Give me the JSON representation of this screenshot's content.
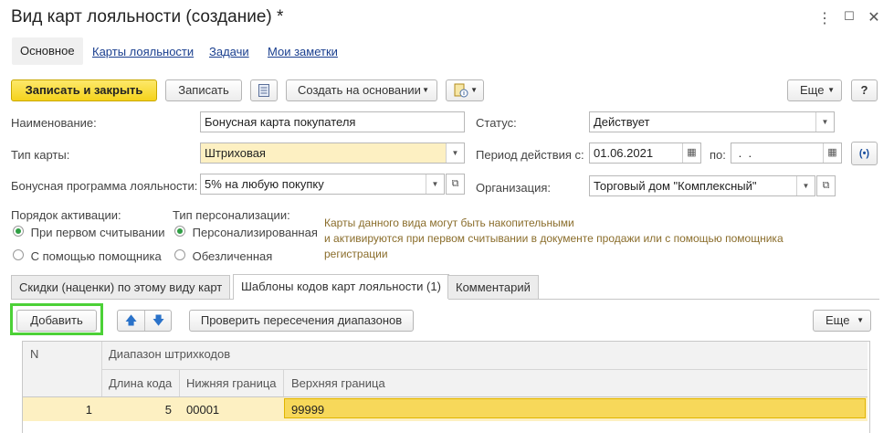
{
  "window": {
    "title": "Вид карт лояльности (создание) *",
    "buttons": [
      "⋮",
      "☐",
      "✕"
    ]
  },
  "nav_tabs": [
    {
      "label": "Основное"
    },
    {
      "label": "Карты лояльности"
    },
    {
      "label": "Задачи"
    },
    {
      "label": "Мои заметки"
    }
  ],
  "toolbar": {
    "save_close_label": "Записать и закрыть",
    "save_label": "Записать",
    "create_based_label": "Создать на основании",
    "more_label": "Еще",
    "help_label": "?"
  },
  "form": {
    "name_label": "Наименование:",
    "name_value": "Бонусная карта покупателя",
    "card_type_label": "Тип карты:",
    "card_type_value": "Штриховая",
    "program_label": "Бонусная программа лояльности:",
    "program_value": "5% на любую покупку",
    "status_label": "Статус:",
    "status_value": "Действует",
    "period_label": "Период действия с:",
    "period_from": "01.06.2021",
    "period_to_label": "по:",
    "period_to": " .  .",
    "org_label": "Организация:",
    "org_value": "Торговый дом \"Комплексный\""
  },
  "activation": {
    "label": "Порядок активации:",
    "options": [
      "При первом считывании",
      "С помощью помощника"
    ],
    "selected": 0
  },
  "personalization": {
    "label": "Тип персонализации:",
    "options": [
      "Персонализированная",
      "Обезличенная"
    ],
    "selected": 0
  },
  "note": {
    "lines": [
      "Карты данного вида могут быть накопительными",
      "и активируются при первом считывании в документе продажи или с помощью помощника",
      "регистрации"
    ]
  },
  "page_tabs": [
    {
      "label": "Скидки (наценки) по этому виду карт"
    },
    {
      "label": "Шаблоны кодов карт лояльности (1)"
    },
    {
      "label": "Комментарий"
    }
  ],
  "grid_toolbar": {
    "add_label": "Добавить",
    "check_label": "Проверить пересечения диапазонов",
    "more_label": "Еще"
  },
  "table": {
    "col_n": "N",
    "group_header": "Диапазон штрихкодов",
    "col_length": "Длина кода",
    "col_lower": "Нижняя граница",
    "col_upper": "Верхняя граница",
    "rows": [
      {
        "n": "1",
        "length": "5",
        "lower": "00001",
        "upper": "99999"
      }
    ]
  },
  "colors": {
    "accent_yellow": "#f5d21c",
    "highlight_green": "#4cd137",
    "selected_row": "#fdf0c2",
    "link_blue": "#1a3f8f"
  }
}
